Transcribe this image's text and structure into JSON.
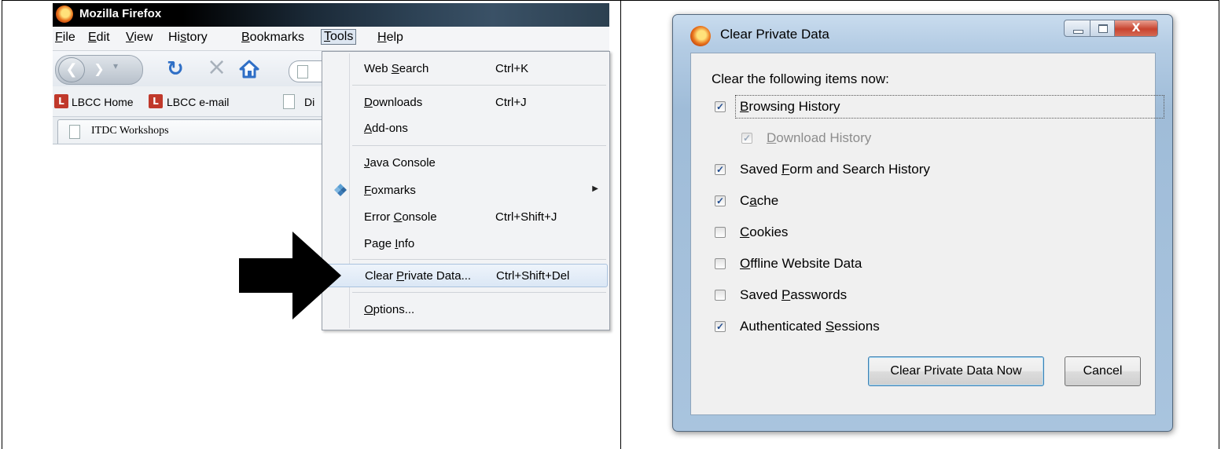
{
  "firefox": {
    "window_title": "Mozilla Firefox",
    "menubar": {
      "file": {
        "u": "F",
        "rest": "ile"
      },
      "edit": {
        "u": "E",
        "rest": "dit"
      },
      "view": {
        "u": "V",
        "rest": "iew"
      },
      "history": {
        "pre": "Hi",
        "u": "s",
        "rest": "tory"
      },
      "bookmarks": {
        "u": "B",
        "rest": "ookmarks"
      },
      "tools": {
        "u": "T",
        "rest": "ools"
      },
      "help": {
        "u": "H",
        "rest": "elp"
      }
    },
    "bookmarks": [
      {
        "label": "LBCC Home",
        "icon": "L"
      },
      {
        "label": "LBCC e-mail",
        "icon": "L"
      },
      {
        "label": "Di"
      }
    ],
    "tab_label": "ITDC Workshops",
    "tools_menu": [
      {
        "pre": "Web ",
        "u": "S",
        "rest": "earch",
        "shortcut": "Ctrl+K"
      },
      {
        "pre": "",
        "u": "D",
        "rest": "ownloads",
        "shortcut": "Ctrl+J"
      },
      {
        "pre": "",
        "u": "A",
        "rest": "dd-ons",
        "shortcut": ""
      },
      {
        "pre": "",
        "u": "J",
        "rest": "ava Console",
        "shortcut": ""
      },
      {
        "pre": "",
        "u": "F",
        "rest": "oxmarks",
        "shortcut": ""
      },
      {
        "pre": "Error ",
        "u": "C",
        "rest": "onsole",
        "shortcut": "Ctrl+Shift+J"
      },
      {
        "pre": "Page ",
        "u": "I",
        "rest": "nfo",
        "shortcut": ""
      },
      {
        "pre": "Clear ",
        "u": "P",
        "rest": "rivate Data...",
        "shortcut": "Ctrl+Shift+Del"
      },
      {
        "pre": "",
        "u": "O",
        "rest": "ptions...",
        "shortcut": ""
      }
    ]
  },
  "dialog": {
    "title": "Clear Private Data",
    "heading": "Clear the following items now:",
    "options": [
      {
        "pre": "",
        "u": "B",
        "rest": "rowsing History",
        "checked": true
      },
      {
        "pre": "",
        "u": "D",
        "rest": "ownload History",
        "checked": true,
        "disabled": true
      },
      {
        "pre": "Saved ",
        "u": "F",
        "rest": "orm and Search History",
        "checked": true
      },
      {
        "pre": "C",
        "u": "a",
        "rest": "che",
        "checked": true
      },
      {
        "pre": "",
        "u": "C",
        "rest": "ookies",
        "checked": false
      },
      {
        "pre": "",
        "u": "O",
        "rest": "ffline Website Data",
        "checked": false
      },
      {
        "pre": "Saved ",
        "u": "P",
        "rest": "asswords",
        "checked": false
      },
      {
        "pre": "Authenticated ",
        "u": "S",
        "rest": "essions",
        "checked": true
      }
    ],
    "primary_button": "Clear Private Data Now",
    "cancel_button": "Cancel",
    "close_glyph": "X"
  }
}
